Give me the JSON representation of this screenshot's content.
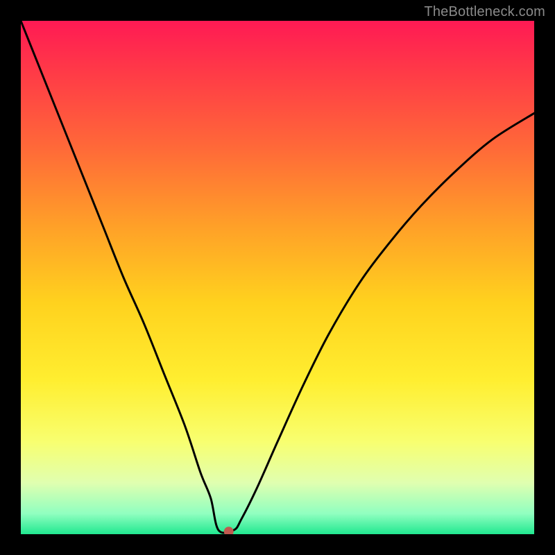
{
  "watermark": "TheBottleneck.com",
  "chart_data": {
    "type": "line",
    "title": "",
    "xlabel": "",
    "ylabel": "",
    "xlim": [
      0,
      100
    ],
    "ylim": [
      0,
      100
    ],
    "background_gradient": {
      "stops": [
        {
          "pos": 0.0,
          "color": "#ff1a54"
        },
        {
          "pos": 0.1,
          "color": "#ff3a47"
        },
        {
          "pos": 0.25,
          "color": "#ff6a38"
        },
        {
          "pos": 0.4,
          "color": "#ffa028"
        },
        {
          "pos": 0.55,
          "color": "#ffd21e"
        },
        {
          "pos": 0.7,
          "color": "#ffee30"
        },
        {
          "pos": 0.82,
          "color": "#f8ff70"
        },
        {
          "pos": 0.9,
          "color": "#e0ffb0"
        },
        {
          "pos": 0.96,
          "color": "#90ffc0"
        },
        {
          "pos": 1.0,
          "color": "#20e890"
        }
      ]
    },
    "series": [
      {
        "name": "bottleneck-curve",
        "color": "#000000",
        "x": [
          0,
          4,
          8,
          12,
          16,
          20,
          24,
          28,
          32,
          35,
          37,
          39,
          40,
          41,
          43,
          46,
          50,
          55,
          60,
          66,
          72,
          78,
          85,
          92,
          100
        ],
        "y": [
          100,
          90,
          80,
          70,
          60,
          50,
          41,
          31,
          21,
          12,
          7,
          3,
          1,
          1,
          3,
          9,
          18,
          29,
          39,
          49,
          57,
          64,
          71,
          77,
          82
        ]
      }
    ],
    "marker": {
      "name": "optimal-point",
      "x": 40.5,
      "y": 0.5,
      "color": "#c05a50",
      "radius_px": 7
    },
    "flat_bottom": {
      "x_start": 38.5,
      "x_end": 41.5,
      "y": 0.8
    }
  }
}
